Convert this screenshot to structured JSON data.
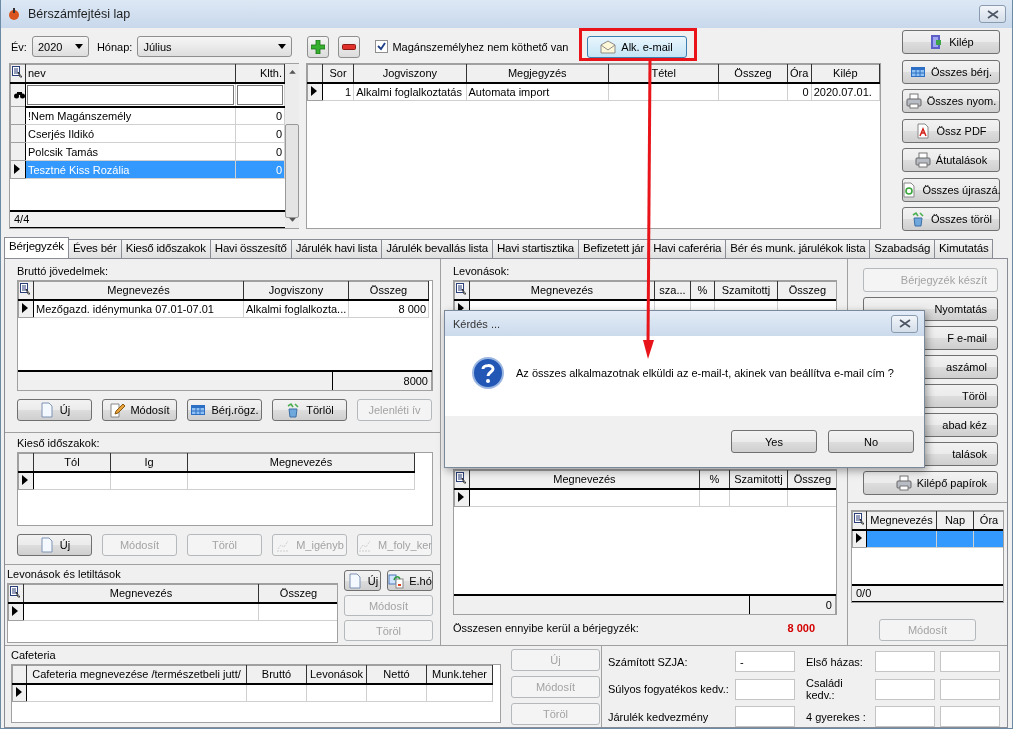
{
  "window": {
    "title": "Bérszámfejtési lap"
  },
  "filter_bar": {
    "year_label": "Év:",
    "year": "2020",
    "month_label": "Hónap:",
    "month": "Július",
    "checkbox": {
      "label": "Magánszemélyhez nem köthető van",
      "checked": true
    },
    "email_button": {
      "label": "Alk. e-mail"
    }
  },
  "employees": {
    "columns": [
      "nev",
      "Klth."
    ],
    "rows": [
      {
        "name": "!Nem Magánszemély",
        "klth": "0",
        "selected": false
      },
      {
        "name": "Cserjés Ildikó",
        "klth": "0",
        "selected": false
      },
      {
        "name": "Polcsik Tamás",
        "klth": "0",
        "selected": false
      },
      {
        "name": "Tesztné Kiss Rozália",
        "klth": "0",
        "selected": true
      }
    ],
    "count": "4/4"
  },
  "entries": {
    "columns": [
      "Sor",
      "Jogviszony",
      "Megjegyzés",
      "Tétel",
      "Összeg",
      "Óra",
      "Kilép"
    ],
    "rows": [
      {
        "cells": [
          "1",
          "Alkalmi foglalkoztatás",
          "Automata import",
          null,
          null,
          "0",
          "2020.07.01."
        ],
        "current": true
      }
    ]
  },
  "side_buttons": [
    {
      "label": "Kilép"
    },
    {
      "label": "Összes bérj."
    },
    {
      "label": "Összes nyom."
    },
    {
      "label": "Össz PDF"
    },
    {
      "label": "Átutalások"
    },
    {
      "label": "Összes újraszá."
    },
    {
      "label": "Összes töröl"
    }
  ],
  "tabs": [
    {
      "label": "Bérjegyzék",
      "selected": true
    },
    {
      "label": "Éves bér",
      "selected": false
    },
    {
      "label": "Kieső időszakok",
      "selected": false
    },
    {
      "label": "Havi összesítő",
      "selected": false
    },
    {
      "label": "Járulék havi lista",
      "selected": false
    },
    {
      "label": "Járulék bevallás lista",
      "selected": false
    },
    {
      "label": "Havi startisztika",
      "selected": false
    },
    {
      "label": "Befizetett jár",
      "selected": false
    },
    {
      "label": "Havi caferéria",
      "selected": false
    },
    {
      "label": "Bér és munk. járulékok lista",
      "selected": false
    },
    {
      "label": "Szabadság",
      "selected": false
    },
    {
      "label": "Kimutatás",
      "selected": false
    }
  ],
  "gross_income": {
    "label": "Bruttó jövedelmek:",
    "columns": [
      "Megnevezés",
      "Jogviszony",
      "Összeg"
    ],
    "rows": [
      {
        "cells": [
          "Mezőgazd. idénymunka 07.01-07.01",
          "Alkalmi foglalkozta...",
          "8 000"
        ],
        "current": true
      }
    ],
    "total": "8000",
    "buttons": [
      {
        "label": "Új",
        "disabled": false
      },
      {
        "label": "Módosít",
        "disabled": false
      },
      {
        "label": "Bérj.rögz.",
        "disabled": false
      },
      {
        "label": "Törlöl",
        "disabled": false
      },
      {
        "label": "Jelenléti ív",
        "disabled": true
      }
    ]
  },
  "absences": {
    "label": "Kieső időszakok:",
    "columns": [
      "Tól",
      "Ig",
      "Megnevezés"
    ],
    "buttons": [
      {
        "label": "Új",
        "disabled": false
      },
      {
        "label": "Módosít",
        "disabled": true
      },
      {
        "label": "Töröl",
        "disabled": true
      },
      {
        "label": "M_igényb",
        "disabled": true
      },
      {
        "label": "M_foly_ker",
        "disabled": true
      }
    ]
  },
  "withholdings": {
    "label": "Levonások és letiltások",
    "columns": [
      "Megnevezés",
      "Összeg"
    ],
    "buttons": [
      {
        "label": "Új",
        "disabled": false
      },
      {
        "label": "E.hó",
        "disabled": false
      },
      {
        "label": "Módosít",
        "disabled": true
      },
      {
        "label": "Töröl",
        "disabled": true
      }
    ]
  },
  "deductions": {
    "label": "Levonások:",
    "columns": [
      "Megnevezés",
      "sza...",
      "%",
      "Szamitottj",
      "Összeg"
    ]
  },
  "contributions": {
    "columns": [
      "Megnevezés",
      "%",
      "Szamitottj",
      "Összeg"
    ],
    "total": "0"
  },
  "cost_total": {
    "label": "Összesen ennyibe kerül a bérjegyzék:",
    "value": "8 000"
  },
  "actions": [
    {
      "label": "Bérjegyzék készít",
      "disabled": true
    },
    {
      "label": "Nyomtatás",
      "disabled": false
    },
    {
      "label": "F e-mail",
      "disabled": false
    },
    {
      "label": "aszámol",
      "disabled": false
    },
    {
      "label": "Töröl",
      "disabled": false
    },
    {
      "label": "abad kéz",
      "disabled": false
    },
    {
      "label": "talások",
      "disabled": false
    },
    {
      "label": "Kilépő papírok",
      "disabled": false
    }
  ],
  "days": {
    "columns": [
      "Megnevezés",
      "Nap",
      "Óra"
    ],
    "rows": [
      {
        "selected": true
      }
    ],
    "count": "0/0",
    "button": {
      "label": "Módosít",
      "disabled": true
    }
  },
  "cafeteria": {
    "label": "Cafeteria",
    "columns": [
      "Cafeteria megnevezése /természetbeli jutt/",
      "Bruttó",
      "Levonások",
      "Nettó",
      "Munk.teher"
    ],
    "buttons": [
      {
        "label": "Új",
        "disabled": true
      },
      {
        "label": "Módosít",
        "disabled": true
      },
      {
        "label": "Töröl",
        "disabled": true
      }
    ]
  },
  "benefits": {
    "left": [
      {
        "label": "Számított SZJA:",
        "value": "-"
      },
      {
        "label": "Súlyos fogyatékos kedv.:"
      },
      {
        "label": "Járulék kedvezmény"
      }
    ],
    "right": [
      {
        "label": "Első házas:"
      },
      {
        "label": "Családi kedv.:"
      },
      {
        "label": "4 gyerekes :"
      }
    ]
  },
  "dialog": {
    "title": "Kérdés ...",
    "message": "Az összes alkalmazotnak elküldi az e-mail-t, akinek van beállítva e-mail cím ?",
    "buttons": [
      "Yes",
      "No"
    ]
  }
}
